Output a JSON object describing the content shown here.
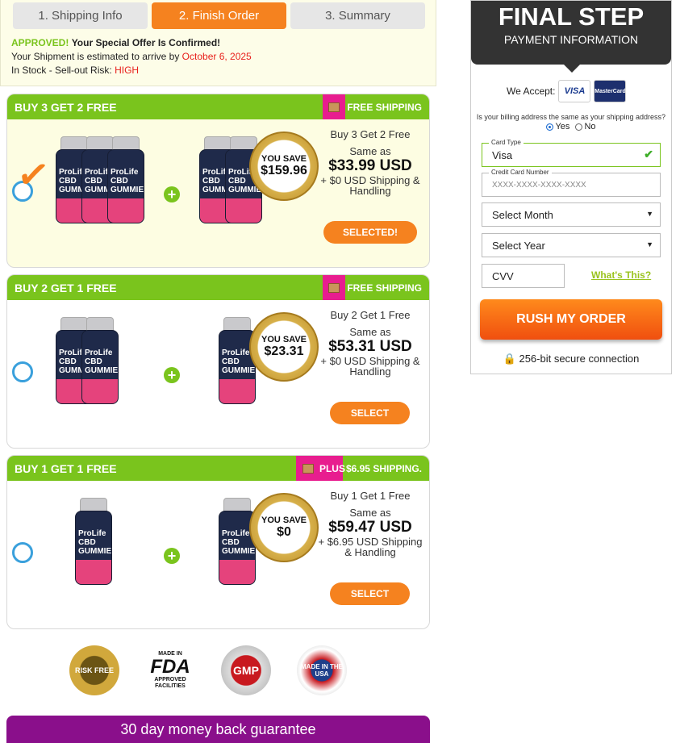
{
  "steps": [
    {
      "label": "1. Shipping Info",
      "active": false
    },
    {
      "label": "2. Finish Order",
      "active": true
    },
    {
      "label": "3. Summary",
      "active": false
    }
  ],
  "status": {
    "approved": "APPROVED!",
    "confirmed": "Your Special Offer Is Confirmed!",
    "shipment_text": "Your Shipment is estimated to arrive by",
    "shipment_date": "October 6, 2025",
    "stock_text": "In Stock - Sell-out Risk:",
    "risk": "HIGH"
  },
  "packages": [
    {
      "title": "BUY 3 GET 2 FREE",
      "ship_tag": "FREE SHIPPING",
      "ship_tag_extra": "",
      "you_save": "YOU SAVE",
      "save_amount": "$159.96",
      "offer_name": "Buy 3 Get 2 Free",
      "same_as": "Same as",
      "price": "$33.99 USD",
      "shipping": "+ $0 USD Shipping & Handling",
      "button": "SELECTED!",
      "selected": true
    },
    {
      "title": "BUY 2 GET 1 FREE",
      "ship_tag": "FREE SHIPPING",
      "ship_tag_extra": "",
      "you_save": "YOU SAVE",
      "save_amount": "$23.31",
      "offer_name": "Buy 2 Get 1 Free",
      "same_as": "Same as",
      "price": "$53.31 USD",
      "shipping": "+ $0 USD Shipping & Handling",
      "button": "SELECT",
      "selected": false
    },
    {
      "title": "BUY 1 GET 1 FREE",
      "ship_tag": "PLUS",
      "ship_tag_extra": "$6.95 SHIPPING.",
      "you_save": "YOU SAVE",
      "save_amount": "$0",
      "offer_name": "Buy 1 Get 1 Free",
      "same_as": "Same as",
      "price": "$59.47 USD",
      "shipping": "+ $6.95 USD Shipping & Handling",
      "button": "SELECT",
      "selected": false
    }
  ],
  "bottle_label": [
    "ProLife",
    "CBD",
    "GUMMIES"
  ],
  "trust_badges": {
    "risk": "RISK FREE",
    "fda": "FDA",
    "fda_made": "MADE IN",
    "fda_sub": "APPROVED FACILITIES",
    "gmp": "GMP",
    "usa": "MADE IN THE USA"
  },
  "guarantee": "30 day money back guarantee",
  "payment": {
    "title": "FINAL STEP",
    "subtitle": "PAYMENT INFORMATION",
    "we_accept": "We Accept:",
    "visa": "VISA",
    "mastercard": "MasterCard",
    "billing_question": "Is your billing address the same as your shipping address?",
    "yes": "Yes",
    "no": "No",
    "card_type_label": "Card Type",
    "card_type_value": "Visa",
    "cc_label": "Credit Card Number",
    "cc_placeholder": "XXXX-XXXX-XXXX-XXXX",
    "month": "Select Month",
    "year": "Select Year",
    "cvv": "CVV",
    "whats_this": "What's This?",
    "rush": "RUSH MY ORDER",
    "secure": "256-bit secure connection"
  }
}
